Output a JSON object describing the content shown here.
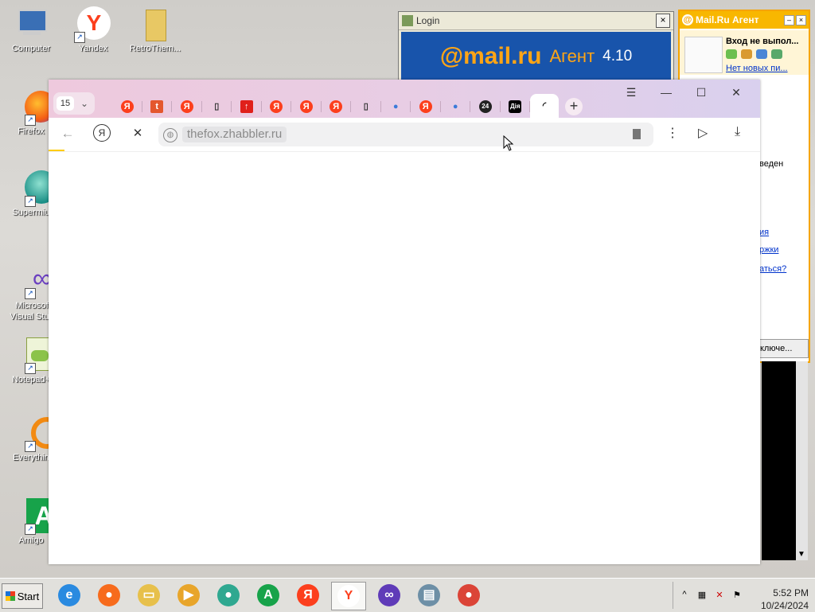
{
  "desktop_icons": [
    {
      "label": "Computer",
      "icon": "computer-icon"
    },
    {
      "label": "Yandex",
      "icon": "yandex-icon"
    },
    {
      "label": "RetroThem...",
      "icon": "folder-icon"
    },
    {
      "label": "Firefox",
      "icon": "firefox-icon"
    },
    {
      "label": "Supermiu",
      "icon": "supermium-icon"
    },
    {
      "label": "Microsof Visual Stud",
      "icon": "visual-studio-icon"
    },
    {
      "label": "Notepad+",
      "icon": "notepad-plus-icon"
    },
    {
      "label": "Everythin",
      "icon": "everything-icon"
    },
    {
      "label": "Amigo",
      "icon": "amigo-icon"
    }
  ],
  "login_window": {
    "title": "Login",
    "close": "×",
    "banner": {
      "brand": "@mail.ru",
      "agent": "Агент",
      "version": "4.10"
    }
  },
  "agent_panel": {
    "title": "Mail.Ru Агент",
    "status": "Вход не выпол...",
    "mail_link": "Нет новых пи...",
    "fragments": [
      "веден",
      "ия",
      "ржки",
      "аться?"
    ],
    "button": "ключе..."
  },
  "browser": {
    "tab_count": "15",
    "tab_chevron": "⌄",
    "tabs": [
      {
        "icon": "yandex-tab-icon",
        "glyph": "Я",
        "color": "#fc3f1d"
      },
      {
        "icon": "t-tab-icon",
        "glyph": "t",
        "color": "#e4572e"
      },
      {
        "icon": "yandex-tab-icon",
        "glyph": "Я",
        "color": "#fc3f1d"
      },
      {
        "icon": "document-tab-icon",
        "glyph": "▯",
        "color": "#333333"
      },
      {
        "icon": "red-square-tab-icon",
        "glyph": "↑",
        "color": "#e0201b"
      },
      {
        "icon": "yandex-tab-icon",
        "glyph": "Я",
        "color": "#fc3f1d"
      },
      {
        "icon": "yandex-tab-icon",
        "glyph": "Я",
        "color": "#fc3f1d"
      },
      {
        "icon": "yandex-tab-icon",
        "glyph": "Я",
        "color": "#fc3f1d"
      },
      {
        "icon": "document-tab-icon",
        "glyph": "▯",
        "color": "#333333"
      },
      {
        "icon": "globe-tab-icon",
        "glyph": "●",
        "color": "#3b7bd9"
      },
      {
        "icon": "yandex-tab-icon",
        "glyph": "Я",
        "color": "#fc3f1d"
      },
      {
        "icon": "globe-tab-icon",
        "glyph": "●",
        "color": "#3b7bd9"
      },
      {
        "icon": "24-tab-icon",
        "glyph": "24",
        "color": "#222222"
      },
      {
        "icon": "dia-tab-icon",
        "glyph": "Дія",
        "color": "#000000"
      },
      {
        "icon": "loading-tab-icon",
        "glyph": "◜",
        "color": "#000000"
      }
    ],
    "new_tab": "+",
    "window_controls": {
      "menu": "☰",
      "minimize": "—",
      "maximize": "☐",
      "close": "✕"
    },
    "nav": {
      "back": "←",
      "yandex": "Я",
      "stop": "✕"
    },
    "url": "thefox.zhabbler.ru",
    "toolbar": {
      "more": "⋮",
      "media": "▷",
      "download": "⤓"
    }
  },
  "taskbar": {
    "start": "Start",
    "apps": [
      {
        "icon": "ie-taskbar-icon",
        "glyph": "e",
        "color": "#2a8ae0"
      },
      {
        "icon": "firefox-taskbar-icon",
        "glyph": "●",
        "color": "#f76b1c"
      },
      {
        "icon": "explorer-taskbar-icon",
        "glyph": "▭",
        "color": "#e7c04b"
      },
      {
        "icon": "media-taskbar-icon",
        "glyph": "▶",
        "color": "#e8a52a"
      },
      {
        "icon": "supermium-taskbar-icon",
        "glyph": "●",
        "color": "#2fa890"
      },
      {
        "icon": "amigo-taskbar-icon",
        "glyph": "A",
        "color": "#17a34a"
      },
      {
        "icon": "yandex-taskbar-icon",
        "glyph": "Я",
        "color": "#fc3f1d"
      },
      {
        "icon": "yandex-browser-taskbar-icon",
        "glyph": "Y",
        "color": "#ffffff",
        "active": true
      },
      {
        "icon": "visual-studio-taskbar-icon",
        "glyph": "∞",
        "color": "#5f3bb8"
      },
      {
        "icon": "window-taskbar-icon",
        "glyph": "▤",
        "color": "#6d8fa6"
      },
      {
        "icon": "chrome-taskbar-icon",
        "glyph": "●",
        "color": "#db4437"
      }
    ],
    "tray_expand": "^",
    "time": "5:52 PM",
    "date": "10/24/2024"
  }
}
